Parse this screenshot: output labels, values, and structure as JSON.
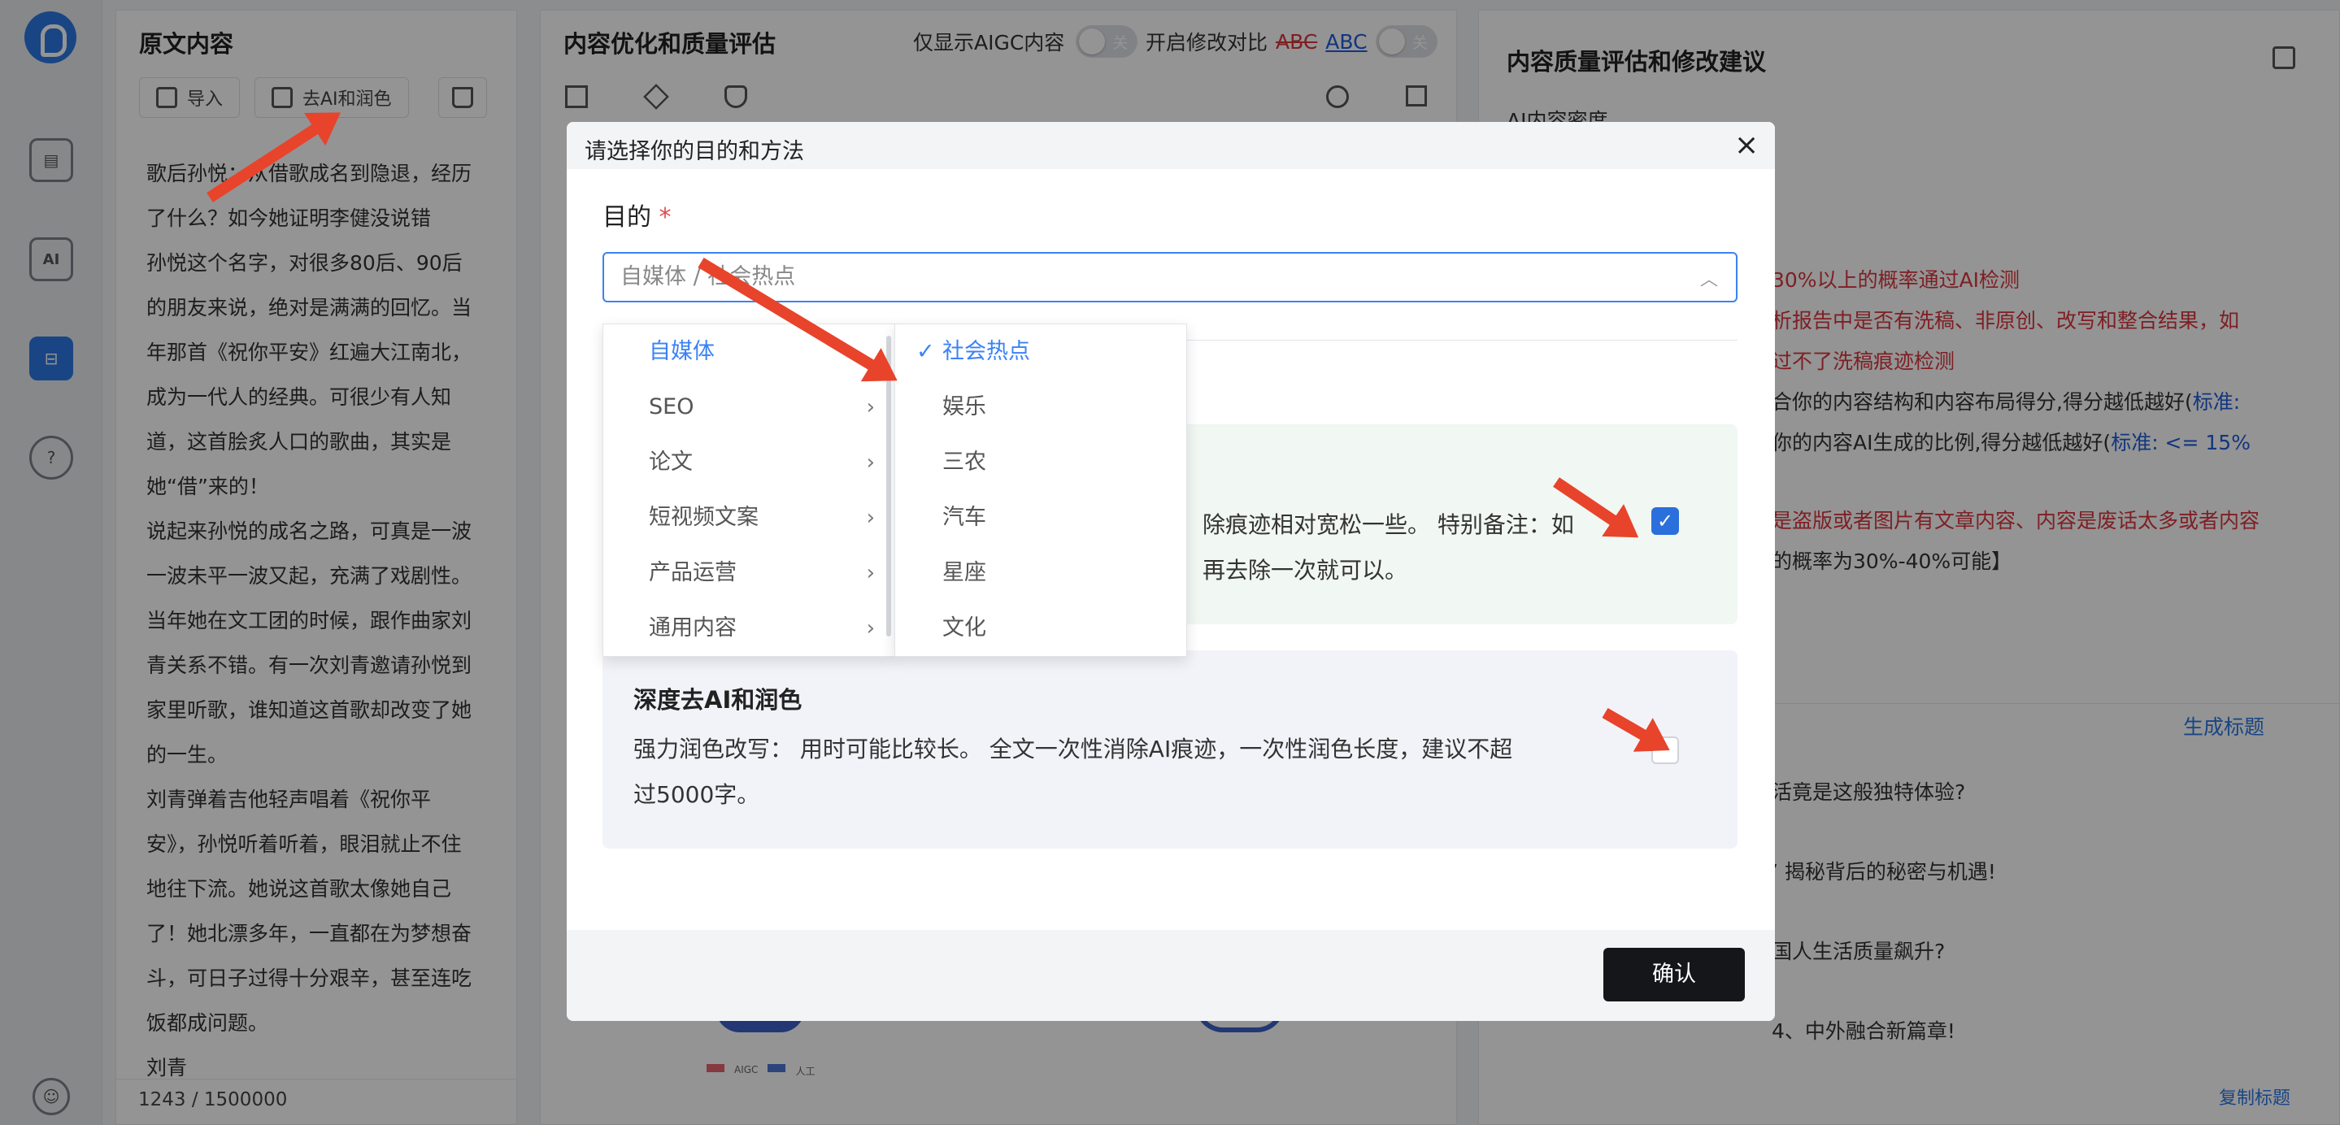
{
  "sidebar": {
    "logo": "D",
    "icons": [
      "report-icon",
      "ai-icon",
      "toolbox-icon",
      "help-icon"
    ],
    "user": "user-icon"
  },
  "original": {
    "title": "原文内容",
    "import_label": "导入",
    "deai_label": "去AI和润色",
    "paragraphs": [
      "歌后孙悦：从借歌成名到隐退，经历了什么？如今她证明李健没说错",
      "孙悦这个名字，对很多80后、90后的朋友来说，绝对是满满的回忆。当年那首《祝你平安》红遍大江南北，成为一代人的经典。可很少有人知道，这首脍炙人口的歌曲，其实是她“借”来的！",
      "说起来孙悦的成名之路，可真是一波一波未平一波又起，充满了戏剧性。当年她在文工团的时候，跟作曲家刘青关系不错。有一次刘青邀请孙悦到家里听歌，谁知道这首歌却改变了她的一生。",
      "刘青弹着吉他轻声唱着《祝你平安》，孙悦听着听着，眼泪就止不住地往下流。她说这首歌太像她自己了！她北漂多年，一直都在为梦想奋斗，可日子过得十分艰辛，甚至连吃饭都成问题。",
      "刘青"
    ],
    "counter": "1243 / 1500000"
  },
  "middle": {
    "title": "内容优化和质量评估",
    "only_aigc_label": "仅显示AIGC内容",
    "compare_label": "开启修改对比",
    "abc_strike": "ABC",
    "abc_link": "ABC",
    "toggle_off": "关",
    "legend": [
      "AIGC",
      "人工"
    ]
  },
  "right": {
    "title": "内容质量评估和修改建议",
    "ai_density": "AI内容密度",
    "lines": [
      "30%以上的概率通过AI检测",
      "析报告中是否有洗稿、非原创、改写和整合结果，如",
      "过不了洗稿痕迹检测",
      "合你的内容结构和内容布局得分,得分越低越好(",
      "标准:",
      "你的内容AI生成的比例,得分越低越好(",
      "标准: <= 15%",
      "是盗版或者图片有文章内容、内容是废话太多或者内容",
      "的概率为30%-40%可能】"
    ],
    "gen_title": "生成标题",
    "titles": [
      "活竟是这般独特体验?",
      "’ 揭秘背后的秘密与机遇!",
      "国人生活质量飙升?",
      "4、中外融合新篇章!"
    ],
    "copy_title": "复制标题"
  },
  "modal": {
    "title": "请选择你的目的和方法",
    "purpose_label": "目的",
    "required": "*",
    "field_value": "自媒体 / 社会热点",
    "cat1": [
      "自媒体",
      "SEO",
      "论文",
      "短视频文案",
      "产品运营",
      "通用内容"
    ],
    "cat2": [
      "社会热点",
      "娱乐",
      "三农",
      "汽车",
      "星座",
      "文化"
    ],
    "check": "✓",
    "card1_line1": "除痕迹相对宽松一些。 特别备注：如",
    "card1_line2": "再去除一次就可以。",
    "card2_title": "深度去AI和润色",
    "card2_desc1": "强力润色改写： 用时可能比较长。 全文一次性消除AI痕迹，一次性润色长度，建议不超",
    "card2_desc2": "过5000字。",
    "confirm": "确认"
  },
  "colors": {
    "accent": "#2b78e4",
    "selected": "#3b82f6",
    "warning": "#d9363e",
    "arrow": "#e8432b"
  }
}
